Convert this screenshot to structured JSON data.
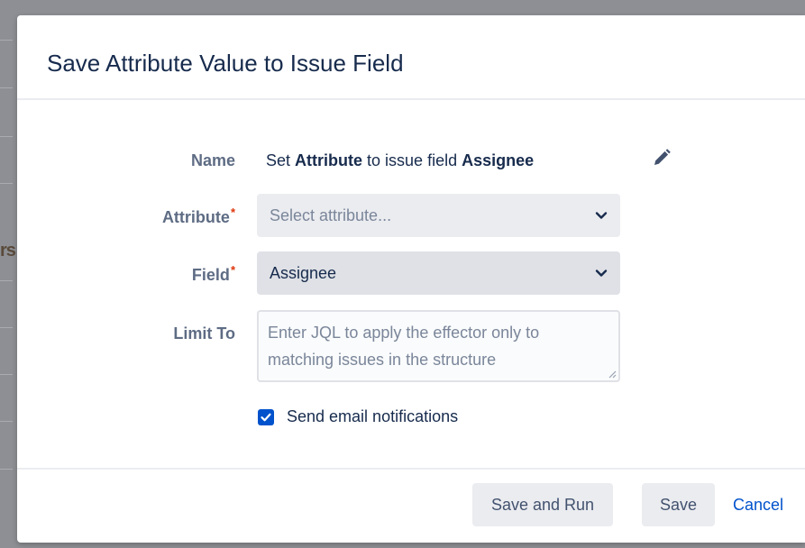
{
  "background": {
    "fragment_text": "rs"
  },
  "dialog": {
    "title": "Save Attribute Value to Issue Field"
  },
  "form": {
    "name_label": "Name",
    "name_value": {
      "prefix": "Set ",
      "attribute_word": "Attribute",
      "middle": " to issue field ",
      "field_word": "Assignee"
    },
    "attribute_label": "Attribute",
    "attribute_placeholder": "Select attribute...",
    "field_label": "Field",
    "field_value": "Assignee",
    "required_marker": "*",
    "limit_label": "Limit To",
    "limit_placeholder": "Enter JQL to apply the effector only to matching issues in the structure",
    "send_email_label": "Send email notifications",
    "send_email_checked": true
  },
  "footer": {
    "save_and_run_label": "Save and Run",
    "save_label": "Save",
    "cancel_label": "Cancel"
  },
  "icons": {
    "edit": "pencil-icon",
    "dropdown": "chevron-down-icon",
    "checkbox": "checkmark-icon",
    "resize": "resize-grip-icon"
  },
  "colors": {
    "accent": "#0052cc",
    "required": "#de350b",
    "text_primary": "#172b4d",
    "text_secondary": "#5e6c84",
    "placeholder": "#7a869a",
    "backdrop": "#8d8f94"
  }
}
